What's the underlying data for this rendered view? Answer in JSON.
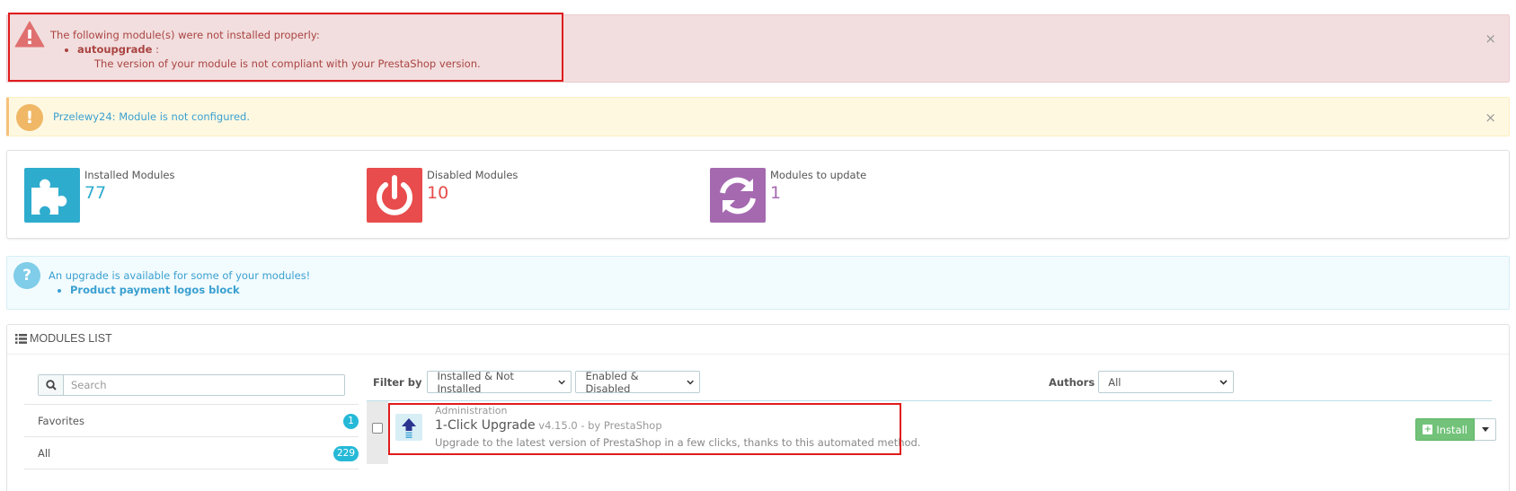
{
  "alerts": {
    "danger": {
      "title": "The following module(s) were not installed properly:",
      "module": "autoupgrade",
      "module_suffix": " :",
      "message": "The version of your module is not compliant with your PrestaShop version.",
      "close": "×"
    },
    "warning": {
      "text": "Przelewy24: Module is not configured.",
      "icon_glyph": "!",
      "close": "×"
    },
    "info": {
      "text": "An upgrade is available for some of your modules!",
      "item": "Product payment logos block",
      "icon_glyph": "?"
    }
  },
  "kpis": [
    {
      "label": "Installed Modules",
      "value": "77",
      "icon": "puzzle-icon",
      "color": "#2eacce"
    },
    {
      "label": "Disabled Modules",
      "value": "10",
      "icon": "power-icon",
      "color": "#e84c4c"
    },
    {
      "label": "Modules to update",
      "value": "1",
      "icon": "refresh-icon",
      "color": "#a569b0"
    }
  ],
  "modules_list": {
    "heading": "MODULES LIST",
    "search_placeholder": "Search",
    "categories": [
      {
        "label": "Favorites",
        "count": "1"
      },
      {
        "label": "All",
        "count": "229"
      }
    ],
    "filter_label": "Filter by",
    "filter_install": "Installed & Not Installed",
    "filter_enabled": "Enabled & Disabled",
    "authors_label": "Authors",
    "authors_value": "All",
    "module": {
      "category": "Administration",
      "name": "1-Click Upgrade",
      "version": " v4.15.0 - by PrestaShop",
      "description": "Upgrade to the latest version of PrestaShop in a few clicks, thanks to this automated method.",
      "install_label": "Install"
    }
  },
  "colors": {
    "accent": "#25b9d7",
    "danger_bg": "#f2dede",
    "warning_bg": "#fff8e1",
    "info_bg": "#f2fbfe",
    "highlight": "#e01c1c",
    "install_green": "#72c279"
  }
}
